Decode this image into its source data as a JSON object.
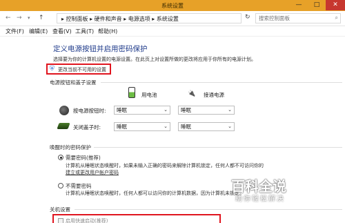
{
  "window": {
    "title": "系统设置",
    "minimize": "—",
    "maximize": "□",
    "close": "✕"
  },
  "address": {
    "crumbs": "▸ 控制面板 ▸ 硬件和声音 ▸ 电源选项 ▸ 系统设置",
    "refresh": "↻",
    "search_placeholder": "搜索控制面板"
  },
  "menu": [
    "文件(F)",
    "编辑(E)",
    "查看(V)",
    "工具(T)",
    "帮助(H)"
  ],
  "page": {
    "heading": "定义电源按钮并启用密码保护",
    "description": "选择要为你的计算机设置的电源设置。在此页上对设置所做的更改将应用于你所有的电源计划。",
    "change_link": "更改当前不可用的设置"
  },
  "power_section": {
    "title": "电源按钮和盖子设置",
    "battery": "用电池",
    "plugged": "接通电源",
    "rows": [
      {
        "label": "按电源按钮时:",
        "battery": "睡眠",
        "plugged": "睡眠"
      },
      {
        "label": "关闭盖子时:",
        "battery": "睡眠",
        "plugged": "睡眠"
      }
    ]
  },
  "password_section": {
    "title": "唤醒时的密码保护",
    "option1_label": "需要密码(推荐)",
    "option1_desc": "计算机从睡眠状态唤醒时，如果未输入正确的密码来解除计算机锁定，任何人都不可访问你的",
    "option1_link": "建立或更改用户帐户密码",
    "option2_label": "不需要密码",
    "option2_desc": "计算机从睡眠状态唤醒时，任何人都可以访问你的计算机数据，因为计算机未锁定。"
  },
  "shutdown_section": {
    "title": "关机设置",
    "fast_startup": "启用快速启动(推荐)"
  },
  "watermark": {
    "main": "百科全说",
    "sub": "助你轻松解决"
  }
}
